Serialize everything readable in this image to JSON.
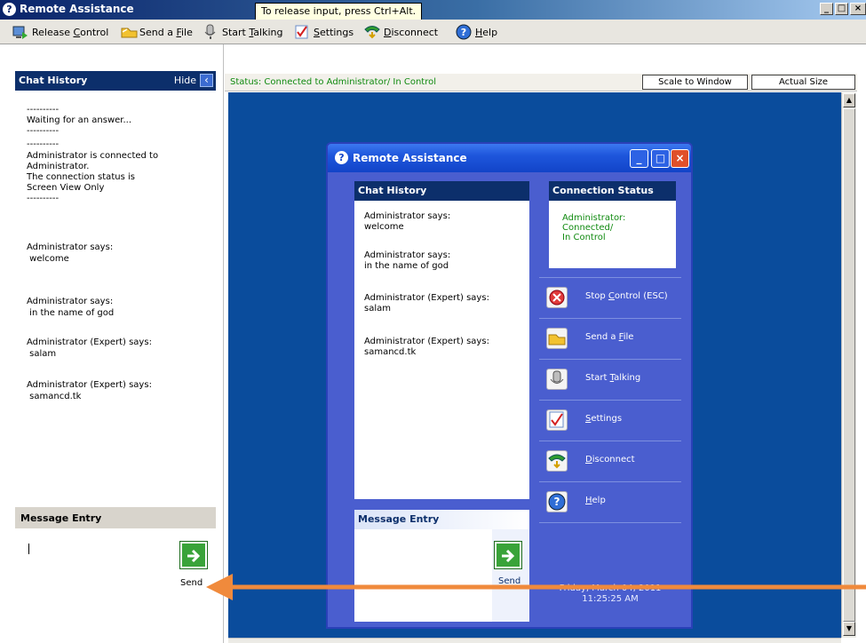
{
  "window": {
    "title": "Remote Assistance",
    "tooltip": "To release input, press Ctrl+Alt."
  },
  "toolbar": {
    "release_control": {
      "pre": "Release ",
      "key": "C",
      "post": "ontrol"
    },
    "send_file": {
      "pre": "Send a ",
      "key": "F",
      "post": "ile"
    },
    "start_talking": {
      "pre": "Start ",
      "key": "T",
      "post": "alking"
    },
    "settings": {
      "pre": "",
      "key": "S",
      "post": "ettings"
    },
    "disconnect": {
      "pre": "",
      "key": "D",
      "post": "isconnect"
    },
    "help": {
      "pre": "",
      "key": "H",
      "post": "elp"
    }
  },
  "left_panel": {
    "chat_title": "Chat History",
    "hide_label": "Hide",
    "chat_lines": [
      "----------",
      "Waiting for an answer...",
      "----------",
      "----------",
      "Administrator is connected to",
      "Administrator.",
      "The connection status is",
      "Screen View Only",
      "----------",
      "Administrator says:",
      " welcome",
      "Administrator says:",
      " in the name of god",
      "Administrator (Expert) says:",
      " salam",
      "Administrator (Expert) says:",
      " samancd.tk"
    ],
    "message_entry_title": "Message Entry",
    "send_label": "Send"
  },
  "status": {
    "text": "Status: Connected to Administrator/ In Control",
    "scale_to_window": "Scale to Window",
    "actual_size": "Actual Size"
  },
  "inner_window": {
    "title": "Remote Assistance",
    "chat_title": "Chat History",
    "chat_lines": [
      "Administrator says:",
      "welcome",
      "Administrator says:",
      "in the name of god",
      "Administrator (Expert) says:",
      "salam",
      "Administrator (Expert) says:",
      "samancd.tk"
    ],
    "connection_title": "Connection Status",
    "connection_lines": [
      "Administrator:",
      "Connected/",
      "In Control"
    ],
    "actions": {
      "stop_control": {
        "pre": "Stop ",
        "key": "C",
        "post": "ontrol (ESC)"
      },
      "send_file": {
        "pre": "Send a ",
        "key": "F",
        "post": "ile"
      },
      "start_talking": {
        "pre": "Start ",
        "key": "T",
        "post": "alking"
      },
      "settings": {
        "pre": "",
        "key": "S",
        "post": "ettings"
      },
      "disconnect": {
        "pre": "",
        "key": "D",
        "post": "isconnect"
      },
      "help": {
        "pre": "",
        "key": "H",
        "post": "elp"
      }
    },
    "message_entry_title": "Message Entry",
    "send_label": "Send",
    "date": "Friday, March 04, 2011",
    "time": "11:25:25 AM"
  },
  "colors": {
    "remote_desktop": "#0a4c9c",
    "status_green": "#108a10",
    "arrow": "#f08a3c",
    "send_green": "#39a339"
  }
}
